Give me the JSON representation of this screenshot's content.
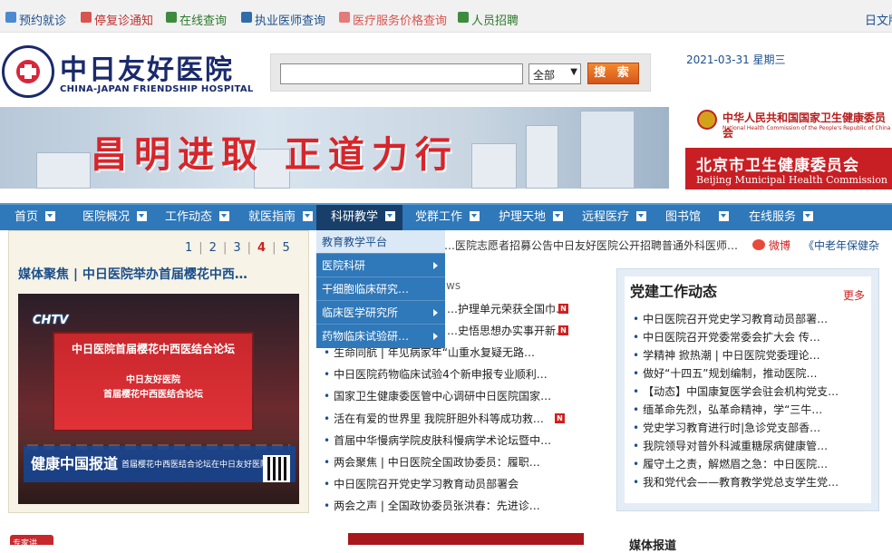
{
  "topbar": {
    "links": [
      "预约就诊",
      "停复诊通知",
      "在线查询",
      "执业医师查询",
      "医疗服务价格查询",
      "人员招聘"
    ],
    "lang": "日文版"
  },
  "logo": {
    "cn": "中日友好医院",
    "en": "CHINA-JAPAN FRIENDSHIP HOSPITAL"
  },
  "search": {
    "placeholder": "",
    "select": "全部",
    "button": "搜 索"
  },
  "date": "2021-03-31 星期三",
  "banner": {
    "slogan": "昌明进取 正道力行"
  },
  "partners": {
    "nhc_cn": "中华人民共和国国家卫生健康委员会",
    "nhc_en": "National Health Commission of the People's Republic of China",
    "bj_cn": "北京市卫生健康委员会",
    "bj_en": "Beijing Municipal Health Commission"
  },
  "nav": {
    "items": [
      "首页",
      "医院概况",
      "工作动态",
      "就医指南",
      "科研教学",
      "党群工作",
      "护理天地",
      "远程医疗",
      "图书馆",
      "在线服务"
    ],
    "dropdown": [
      "教育教学平台",
      "医院科研",
      "干细胞临床研究…",
      "临床医学研究所",
      "药物临床试验研…"
    ]
  },
  "focus": {
    "pages": [
      "1",
      "2",
      "3",
      "4",
      "5"
    ],
    "title": "媒体聚焦 | 中日医院举办首届樱花中西…",
    "chtv": "CHTV",
    "stage_title": "中日医院首届樱花中西医结合论坛",
    "stage_l2": "中日友好医院",
    "stage_l3": "首届樱花中西医结合论坛",
    "lower_brand": "健康中国报道",
    "lower_text": "首届樱花中西医结合论坛在中日友好医院举办"
  },
  "ticker": [
    "…医院志愿者招募公告",
    "中日友好医院公开招聘普通外科医师…",
    "微博",
    "《中老年保健杂"
  ],
  "news_tab": "ws",
  "news": [
    "…护理单元荣获全国巾…",
    "…史悟思想办实事开新…",
    "生命同航 | 年见病家年“山重水复疑无路…",
    "中日医院药物临床试验4个新申报专业顺利…",
    "国家卫生健康委医管中心调研中日医院国家…",
    "活在有爱的世界里 我院肝胆外科等成功救…",
    "首届中华慢病学院皮肤科慢病学术论坛暨中…",
    "两会聚焦 | 中日医院全国政协委员：履职…",
    "中日医院召开党史学习教育动员部署会",
    "两会之声 | 全国政协委员张洪春：先进诊…"
  ],
  "party": {
    "title": "党建工作动态",
    "more": "更多",
    "items": [
      "中日医院召开党史学习教育动员部署…",
      "中日医院召开党委常委会扩大会 传…",
      "学精神 掀热潮 | 中日医院党委理论…",
      "做好“十四五”规划编制，推动医院…",
      "【动态】中国康复医学会驻会机构党支…",
      "缅革命先烈，弘革命精神，学“三牛…",
      "党史学习教育进行时|急诊党支部香…",
      "我院领导对普外科減重糖尿病健康管…",
      "履守土之责，解燃眉之急：中日医院…",
      "我和党代会——教育教学党总支学生党…"
    ]
  },
  "footer": {
    "left": "专家讲",
    "right": "媒体报道"
  }
}
